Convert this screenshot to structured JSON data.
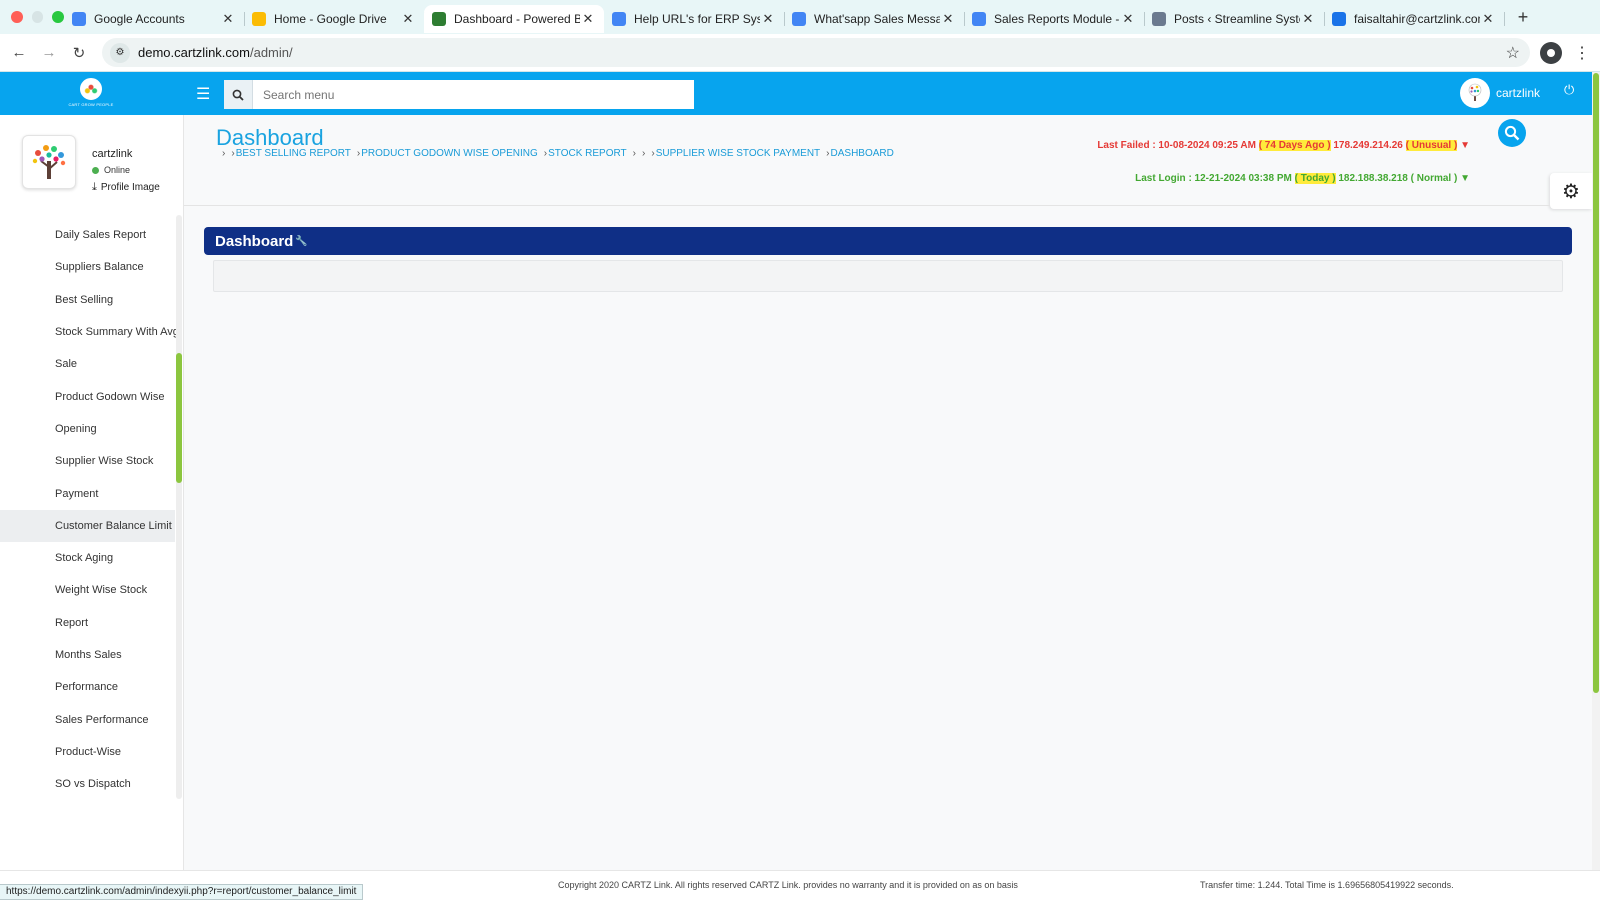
{
  "browser": {
    "tabs": [
      {
        "title": "Google Accounts",
        "icon": "google-icon",
        "color": "#4285f4"
      },
      {
        "title": "Home - Google Drive",
        "icon": "google-drive-icon",
        "color": "#fbbc04"
      },
      {
        "title": "Dashboard - Powered By",
        "icon": "cartzlink-favicon",
        "color": "#2e7d32",
        "active": true
      },
      {
        "title": "Help URL's for ERP Syste",
        "icon": "google-docs-icon",
        "color": "#4285f4"
      },
      {
        "title": "What'sapp Sales Messag",
        "icon": "google-docs-icon",
        "color": "#4285f4"
      },
      {
        "title": "Sales Reports Module - G",
        "icon": "google-docs-icon",
        "color": "#4285f4"
      },
      {
        "title": "Posts ‹ Streamline Syster",
        "icon": "wordpress-icon",
        "color": "#6b7a8f"
      },
      {
        "title": "faisaltahir@cartzlink.com",
        "icon": "mail-icon",
        "color": "#1a73e8"
      }
    ],
    "url_host": "demo.cartzlink.com",
    "url_path": "/admin/",
    "status_url": "https://demo.cartzlink.com/admin/indexyii.php?r=report/customer_balance_limit"
  },
  "header": {
    "search_placeholder": "Search menu",
    "username": "cartzlink"
  },
  "profile": {
    "name": "cartzlink",
    "status": "Online",
    "image_link": "Profile Image"
  },
  "sidebar": {
    "items": [
      {
        "label": "Daily Sales Report"
      },
      {
        "label": "Suppliers Balance"
      },
      {
        "label": "Best Selling"
      },
      {
        "label": "Stock Summary With Avg"
      },
      {
        "label": "Sale"
      },
      {
        "label": "Product Godown Wise"
      },
      {
        "label": "Opening"
      },
      {
        "label": "Supplier Wise Stock"
      },
      {
        "label": "Payment"
      },
      {
        "label": "Customer Balance Limit",
        "hovered": true
      },
      {
        "label": "Stock Aging"
      },
      {
        "label": "Weight Wise Stock"
      },
      {
        "label": "Report"
      },
      {
        "label": "Months Sales"
      },
      {
        "label": "Performance"
      },
      {
        "label": "Sales Performance"
      },
      {
        "label": "Product-Wise"
      },
      {
        "label": "SO vs Dispatch"
      }
    ]
  },
  "main": {
    "title": "Dashboard",
    "breadcrumbs": [
      "",
      "Best Selling Report",
      "Product Godown Wise Opening",
      "Stock Report",
      "",
      "",
      "Supplier Wise Stock Payment",
      "Dashboard"
    ],
    "last_failed": {
      "label": "Last Failed : 10-08-2024 09:25 AM",
      "ago": "( 74 Days Ago )",
      "ip": "178.249.214.26",
      "flag": "( Unusual )"
    },
    "last_login": {
      "label": "Last Login : 12-21-2024 03:38 PM",
      "ago": "( Today )",
      "ip": "182.188.38.218",
      "flag": "( Normal )"
    },
    "panel_title": "Dashboard"
  },
  "footer": {
    "copyright": "Copyright 2020 CARTZ Link. All rights reserved CARTZ Link. provides no warranty and it is provided on as on basis",
    "transfer": "Transfer time: 1.244. Total Time is 1.69656805419922 seconds."
  },
  "colors": {
    "header_blue": "#07a4ee",
    "panel_navy": "#0f2f86",
    "failed_red": "#e53935",
    "login_green": "#43a832",
    "scroll_green": "#8cc63f"
  }
}
